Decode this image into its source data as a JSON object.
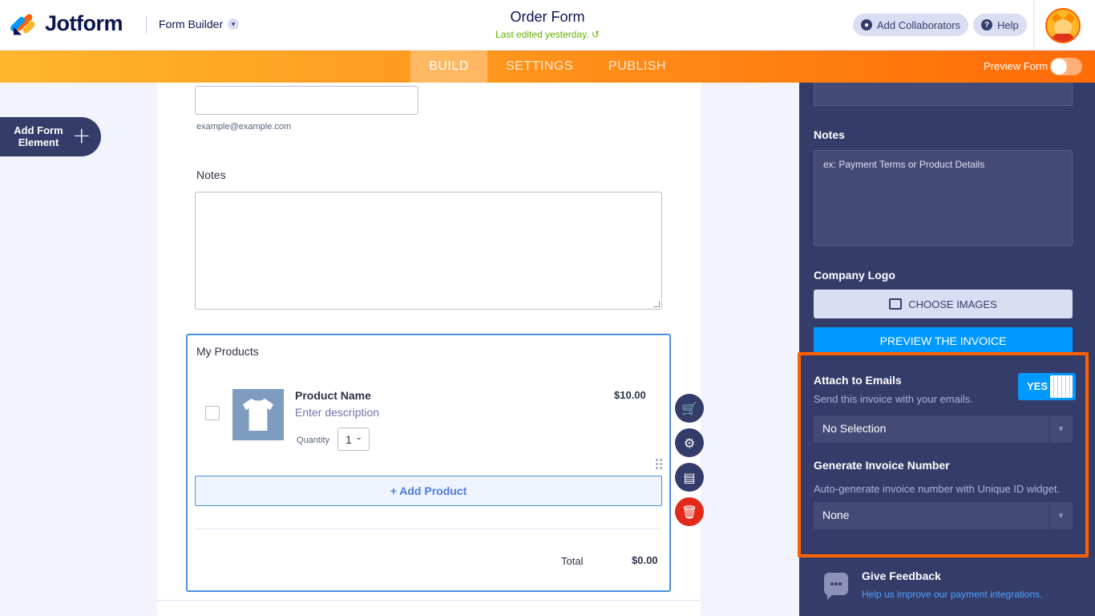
{
  "header": {
    "logo_text": "Jotform",
    "builder_label": "Form Builder",
    "form_title": "Order Form",
    "last_edited": "Last edited yesterday.",
    "add_collaborators": "Add Collaborators",
    "help": "Help"
  },
  "nav": {
    "tabs": [
      {
        "label": "BUILD",
        "active": true
      },
      {
        "label": "SETTINGS",
        "active": false
      },
      {
        "label": "PUBLISH",
        "active": false
      }
    ],
    "preview_form": "Preview Form",
    "preview_enabled": false
  },
  "left": {
    "add_form_element": "Add Form Element",
    "add_form_element_line1": "Add Form",
    "add_form_element_line2": "Element"
  },
  "form": {
    "email_sublabel": "example@example.com",
    "notes_label": "Notes",
    "products": {
      "label": "My Products",
      "items": [
        {
          "name": "Product Name",
          "description": "Enter description",
          "quantity_label": "Quantity",
          "quantity": "1",
          "price": "$10.00"
        }
      ],
      "add_product": "+ Add Product",
      "total_label": "Total",
      "total_value": "$0.00"
    }
  },
  "panel": {
    "notes_label": "Notes",
    "notes_placeholder": "ex: Payment Terms or Product Details",
    "company_logo_label": "Company Logo",
    "choose_images": "CHOOSE IMAGES",
    "preview_invoice": "PREVIEW THE INVOICE",
    "attach_to_emails": {
      "title": "Attach to Emails",
      "description": "Send this invoice with your emails.",
      "toggle_label": "YES",
      "selection": "No Selection"
    },
    "generate_invoice_number": {
      "title": "Generate Invoice Number",
      "description": "Auto-generate invoice number with Unique ID widget.",
      "selection": "None"
    },
    "feedback": {
      "title": "Give Feedback",
      "link": "Help us improve our payment integrations."
    }
  },
  "colors": {
    "brand_orange": "#ff6100",
    "brand_blue": "#0099ff",
    "panel_bg": "#343c6a",
    "highlight": "#ff6100"
  }
}
